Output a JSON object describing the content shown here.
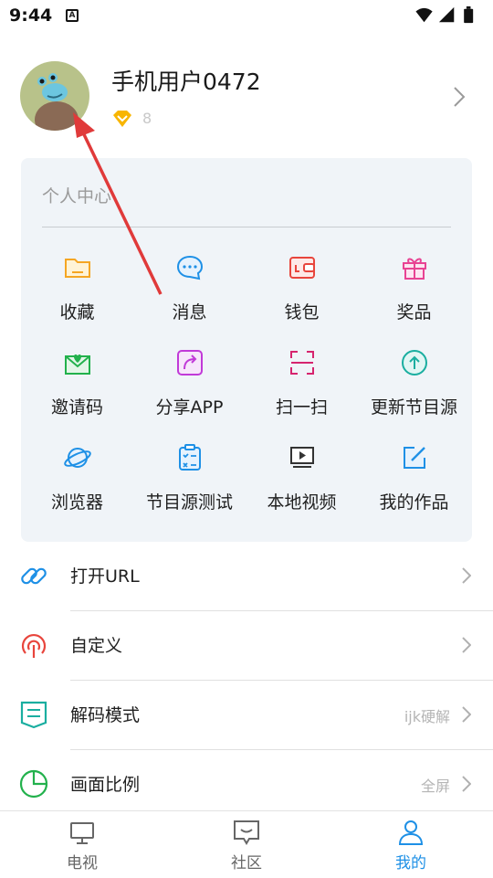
{
  "status_bar": {
    "time": "9:44",
    "notification_icon": "a-icon",
    "wifi_icon": "wifi-icon",
    "signal_icon": "cell-signal-icon",
    "battery_icon": "battery-icon"
  },
  "profile": {
    "username": "手机用户0472",
    "level": "8",
    "vip_icon": "diamond-icon",
    "avatar_icon": "avatar-image",
    "chevron_icon": "chevron-right-icon"
  },
  "personal_center": {
    "title": "个人中心",
    "items": [
      {
        "label": "收藏",
        "icon": "folder-icon",
        "color": "#f5a623"
      },
      {
        "label": "消息",
        "icon": "chat-bubble-icon",
        "color": "#1e90e6"
      },
      {
        "label": "钱包",
        "icon": "wallet-icon",
        "color": "#e8453c"
      },
      {
        "label": "奖品",
        "icon": "gift-icon",
        "color": "#e84393"
      },
      {
        "label": "邀请码",
        "icon": "envelope-heart-icon",
        "color": "#22b14c"
      },
      {
        "label": "分享APP",
        "icon": "share-icon",
        "color": "#c13ad8"
      },
      {
        "label": "扫一扫",
        "icon": "scan-icon",
        "color": "#d6246e"
      },
      {
        "label": "更新节目源",
        "icon": "upload-circle-icon",
        "color": "#1aaea0"
      },
      {
        "label": "浏览器",
        "icon": "planet-icon",
        "color": "#1e90e6"
      },
      {
        "label": "节目源测试",
        "icon": "clipboard-check-icon",
        "color": "#1e90e6"
      },
      {
        "label": "本地视频",
        "icon": "video-icon",
        "color": "#333333"
      },
      {
        "label": "我的作品",
        "icon": "edit-square-icon",
        "color": "#1e90e6"
      }
    ]
  },
  "settings_list": [
    {
      "label": "打开URL",
      "value": "",
      "icon": "link-icon",
      "color": "#1e90e6"
    },
    {
      "label": "自定义",
      "value": "",
      "icon": "broadcast-icon",
      "color": "#e8453c"
    },
    {
      "label": "解码模式",
      "value": "ijk硬解",
      "icon": "decode-doc-icon",
      "color": "#1aaea0"
    },
    {
      "label": "画面比例",
      "value": "全屏",
      "icon": "pie-chart-icon",
      "color": "#22b14c"
    }
  ],
  "tabbar": {
    "tabs": [
      {
        "label": "电视",
        "icon": "tv-icon",
        "active": false
      },
      {
        "label": "社区",
        "icon": "community-chat-icon",
        "active": false
      },
      {
        "label": "我的",
        "icon": "user-icon",
        "active": true
      }
    ],
    "active_color": "#1e90e6"
  },
  "annotation": {
    "arrow_color": "#e03a3a"
  }
}
